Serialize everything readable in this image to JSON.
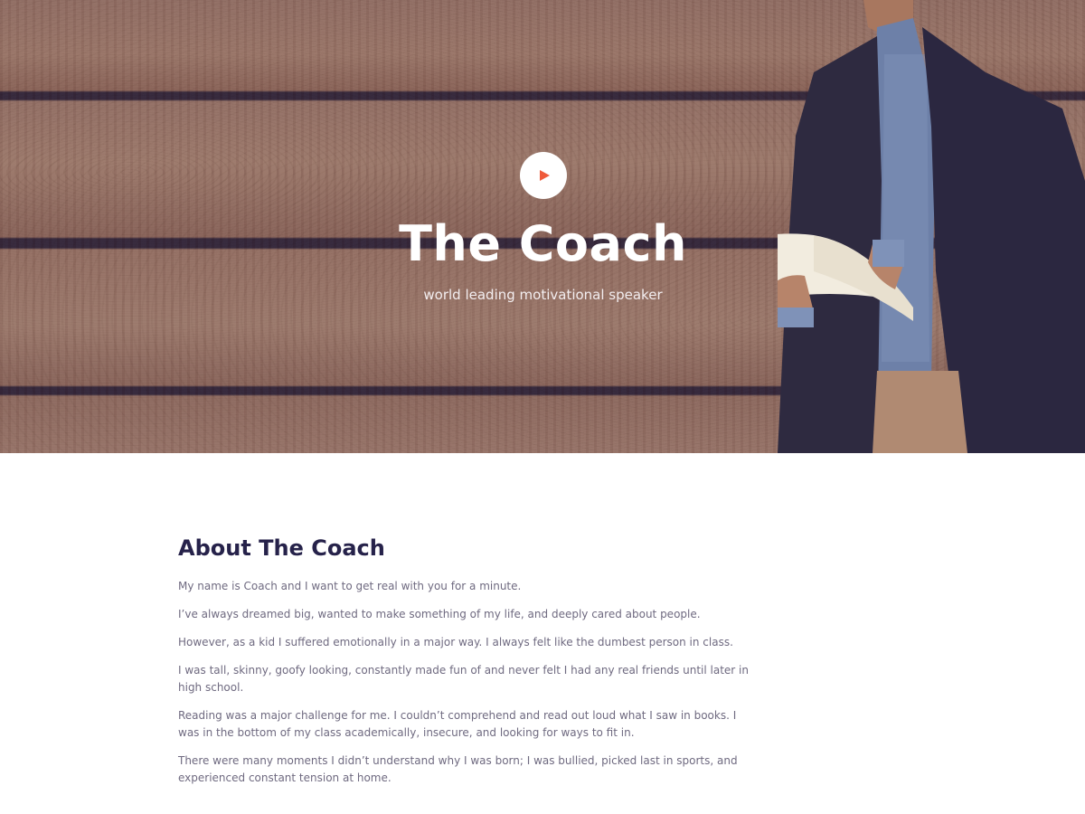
{
  "hero": {
    "title": "The Coach",
    "subtitle": "world leading motivational speaker",
    "play_icon": "play-icon",
    "play_color": "#ef5a3a"
  },
  "about": {
    "title": "About The Coach",
    "paragraphs": [
      "My name is Coach and I want to get real with you for a minute.",
      "I’ve always dreamed big, wanted to make something of my life, and deeply cared about people.",
      "However, as a kid I suffered emotionally in a major way. I always felt like the dumbest person in class.",
      "I was tall, skinny, goofy looking, constantly made fun of and never felt I had any real friends until later in high school.",
      "Reading was a major challenge for me. I couldn’t comprehend and read out loud what I saw in books. I was in the bottom of my class academically, insecure, and looking for ways to fit in.",
      "There were many moments I didn’t understand why I was born; I was bullied, picked last in sports, and experienced constant tension at home."
    ]
  },
  "colors": {
    "heading": "#26224a",
    "body_text": "#6f6a80",
    "accent": "#ef5a3a"
  }
}
